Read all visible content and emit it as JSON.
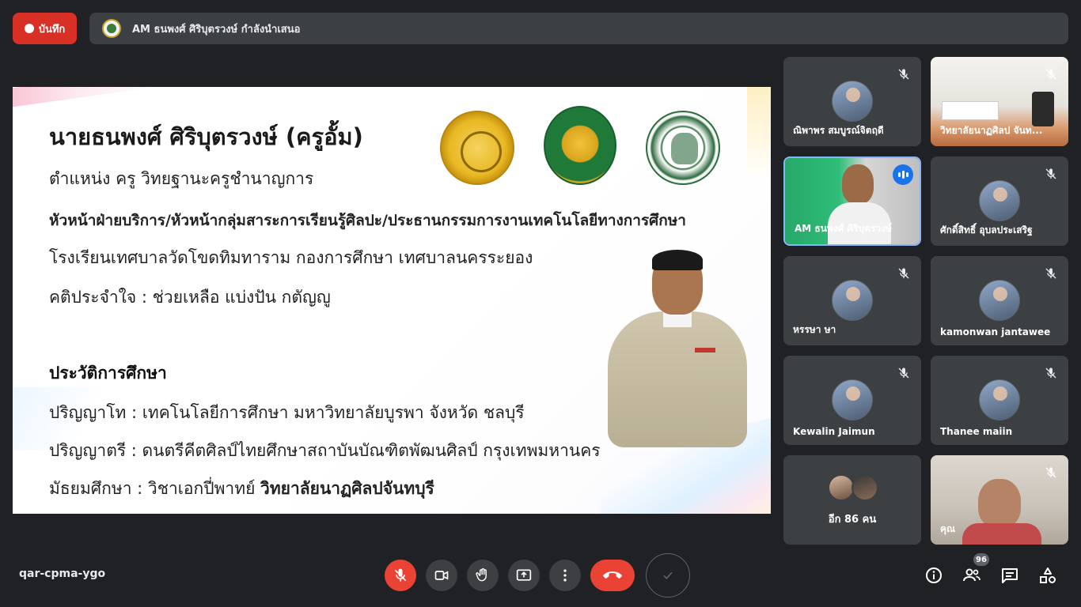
{
  "top_bar": {
    "record_label": "บันทึก",
    "presenting_text": "AM ธนพงศ์ ศิริบุตรวงษ์ กำลังนำเสนอ"
  },
  "slide": {
    "title": "นายธนพงศ์  ศิริบุตรวงษ์ (ครูอั้ม)",
    "position": "ตำแหน่ง ครู วิทยฐานะครูชำนาญการ",
    "roles": "หัวหน้าฝ่ายบริการ/หัวหน้ากลุ่มสาระการเรียนรู้ศิลปะ/ประธานกรรมการงานเทคโนโลยีทางการศึกษา",
    "school": "โรงเรียนเทศบาลวัดโขดทิมทาราม  กองการศึกษา เทศบาลนครระยอง",
    "motto": "คติประจำใจ : ช่วยเหลือ  แบ่งปัน  กตัญญู",
    "education_heading": "ประวัติการศึกษา",
    "masters": "ปริญญาโท   : เทคโนโลยีการศึกษา มหาวิทยาลัยบูรพา จังหวัด ชลบุรี",
    "bachelors": "ปริญญาตรี   :  ดนตรีคีตศิลป์ไทยศึกษาสถาบันบัณฑิตพัฒนศิลป์ กรุงเทพมหานคร",
    "secondary_prefix": "มัธยมศึกษา : วิชาเอกปี่พาทย์ ",
    "secondary_bold": "วิทยาลัยนาฏศิลปจันทบุรี"
  },
  "participants": [
    {
      "name": "ณิพาพร สมบูรณ์จิตฤดี"
    },
    {
      "name": "วิทยาลัยนาฏศิลป จันท..."
    },
    {
      "name": "AM ธนพงศ์ ศิริบุตรวงษ์"
    },
    {
      "name": "ศักดิ์สิทธิ์ อุบลประเสริฐ"
    },
    {
      "name": "หรรษา ษา"
    },
    {
      "name": "kamonwan jantawee"
    },
    {
      "name": "Kewalin Jaimun"
    },
    {
      "name": "Thanee maiin"
    },
    {
      "name": "อีก 86 คน"
    },
    {
      "name": "คุณ"
    }
  ],
  "bottom_bar": {
    "meeting_code": "qar-cpma-ygo",
    "participant_count": "96"
  },
  "icons": {
    "mic": "mic-off-icon",
    "camera": "camera-icon",
    "hand": "raise-hand-icon",
    "present": "present-screen-icon",
    "more": "more-vert-icon",
    "hangup": "hangup-icon",
    "info": "info-icon",
    "people": "people-icon",
    "chat": "chat-icon",
    "activities": "activities-icon"
  },
  "colors": {
    "record_red": "#d93025",
    "hangup_red": "#ea4335",
    "active_border": "#8ab4f8",
    "speaking_blue": "#1a73e8"
  }
}
